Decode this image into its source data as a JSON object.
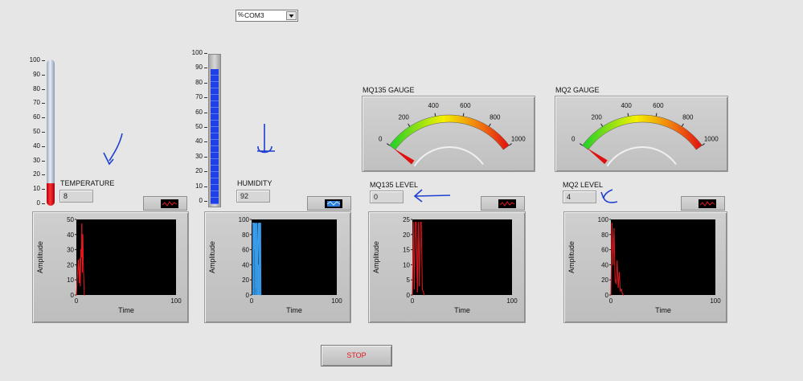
{
  "port": {
    "value": "COM3",
    "prefix_glyph": "%"
  },
  "temperature": {
    "label": "TEMPERATURE",
    "value": "8",
    "scale_ticks": [
      "100",
      "90",
      "80",
      "70",
      "60",
      "50",
      "40",
      "30",
      "20",
      "10",
      "0"
    ],
    "level_fraction": 0.08,
    "chart_data": {
      "type": "line",
      "xlabel": "Time",
      "ylabel": "Amplitude",
      "xlim": [
        0,
        100
      ],
      "ylim": [
        0,
        50
      ],
      "xticks": [
        "0",
        "100"
      ],
      "yticks": [
        "50",
        "40",
        "30",
        "20",
        "10",
        "0"
      ],
      "color": "#e5191f",
      "x": [
        0,
        1,
        2,
        3,
        3.5,
        4,
        4.5,
        5,
        5.5,
        6,
        6.5,
        7,
        7.5,
        8
      ],
      "y": [
        0,
        12,
        23,
        8,
        24,
        6,
        30,
        25,
        47,
        15,
        40,
        20,
        9,
        0
      ]
    }
  },
  "humidity": {
    "label": "HUMIDITY",
    "value": "92",
    "scale_ticks": [
      "100",
      "90",
      "80",
      "70",
      "60",
      "50",
      "40",
      "30",
      "20",
      "10",
      "0"
    ],
    "level_fraction": 0.92,
    "chart_data": {
      "type": "area",
      "xlabel": "Time",
      "ylabel": "Amplitude",
      "xlim": [
        0,
        100
      ],
      "ylim": [
        0,
        100
      ],
      "xticks": [
        "0",
        "100"
      ],
      "yticks": [
        "100",
        "80",
        "60",
        "40",
        "20",
        "0"
      ],
      "color": "#3aa0f0",
      "x": [
        1,
        2,
        3,
        3.5,
        4,
        5,
        5.5,
        6,
        7,
        8,
        9,
        10,
        10.5,
        11
      ],
      "y": [
        95,
        95,
        95,
        60,
        95,
        10,
        95,
        95,
        40,
        95,
        95,
        95,
        95,
        0
      ]
    }
  },
  "mq135": {
    "gauge_label": "MQ135 GAUGE",
    "level_label": "MQ135 LEVEL",
    "value": "0",
    "gauge_ticks": [
      "0",
      "200",
      "400",
      "600",
      "800",
      "1000"
    ],
    "gauge_value": 0,
    "gauge_max": 1000,
    "chart_data": {
      "type": "line",
      "xlabel": "Time",
      "ylabel": "Amplitude",
      "xlim": [
        0,
        100
      ],
      "ylim": [
        0,
        25
      ],
      "xticks": [
        "0",
        "100"
      ],
      "yticks": [
        "25",
        "20",
        "15",
        "10",
        "5",
        "0"
      ],
      "color": "#e5191f",
      "x": [
        0,
        1,
        2,
        3,
        4,
        5,
        6,
        7,
        8,
        9,
        10,
        11,
        12
      ],
      "y": [
        0,
        24,
        2,
        24,
        24,
        1,
        24,
        3,
        24,
        24,
        2,
        1,
        0
      ]
    }
  },
  "mq2": {
    "gauge_label": "MQ2 GAUGE",
    "level_label": "MQ2 LEVEL",
    "value": "4",
    "gauge_ticks": [
      "0",
      "200",
      "400",
      "600",
      "800",
      "1000"
    ],
    "gauge_value": 4,
    "gauge_max": 1000,
    "chart_data": {
      "type": "line",
      "xlabel": "Time",
      "ylabel": "Amplitude",
      "xlim": [
        0,
        100
      ],
      "ylim": [
        0,
        100
      ],
      "xticks": [
        "0",
        "100"
      ],
      "yticks": [
        "100",
        "80",
        "60",
        "40",
        "20",
        "0"
      ],
      "color": "#e5191f",
      "x": [
        0,
        1,
        2,
        3,
        4,
        5,
        6,
        7,
        8,
        9,
        10,
        11,
        12
      ],
      "y": [
        0,
        95,
        40,
        88,
        20,
        15,
        45,
        10,
        30,
        5,
        8,
        2,
        0
      ]
    }
  },
  "stop_label": "STOP"
}
